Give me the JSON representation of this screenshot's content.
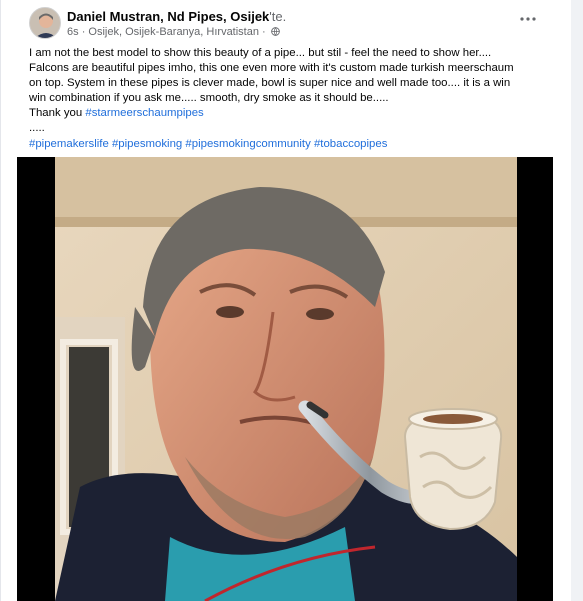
{
  "post": {
    "author": "Daniel Mustran, Nd Pipes, Osijek",
    "author_suffix": "'te.",
    "time": "6s",
    "location": "Osijek, Osijek-Baranya, Hırvatistan",
    "separator": "·",
    "more_icon": "more-horizontal-icon",
    "privacy_icon": "globe-icon",
    "text_lines": [
      "I am not the best model to show this beauty of a pipe... but stil - feel the need to show her....",
      "Falcons are beautiful pipes imho, this one even more with it's custom made turkish meerschaum",
      "on top. System in these pipes is clever made, bowl is super nice and well made too.... it is a win",
      "win combination if you ask me..... smooth, dry smoke as it should be....."
    ],
    "thanks_prefix": "Thank you ",
    "thanks_tag": "#starmeerschaumpipes",
    "ellipsis": ".....",
    "hashtags": [
      "#pipemakerslife",
      "#pipesmoking",
      "#pipesmokingcommunity",
      "#tobaccopipes"
    ]
  },
  "colors": {
    "link": "#216fdb",
    "secondary_text": "#65676b",
    "page_bg": "#f0f2f5"
  }
}
